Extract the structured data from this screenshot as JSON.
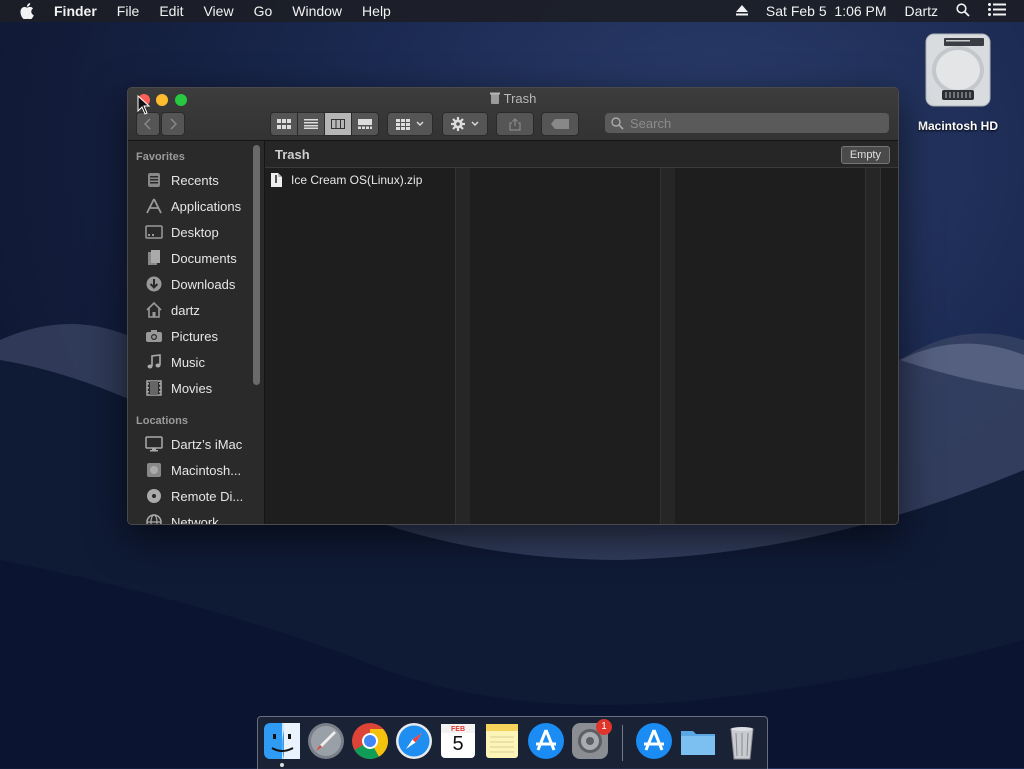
{
  "menubar": {
    "app_name": "Finder",
    "menus": [
      "File",
      "Edit",
      "View",
      "Go",
      "Window",
      "Help"
    ],
    "datetime": "Sat Feb 5  1:06 PM",
    "user": "Dartz"
  },
  "desktop": {
    "hd_label": "Macintosh HD"
  },
  "window": {
    "title": "Trash",
    "search_placeholder": "Search",
    "path_title": "Trash",
    "empty_label": "Empty",
    "files": [
      {
        "name": "Ice Cream OS(Linux).zip",
        "icon": "document-icon"
      }
    ]
  },
  "sidebar": {
    "favorites_header": "Favorites",
    "favorites": [
      {
        "label": "Recents",
        "icon": "recents-icon"
      },
      {
        "label": "Applications",
        "icon": "applications-icon"
      },
      {
        "label": "Desktop",
        "icon": "desktop-icon"
      },
      {
        "label": "Documents",
        "icon": "documents-icon"
      },
      {
        "label": "Downloads",
        "icon": "downloads-icon"
      },
      {
        "label": "dartz",
        "icon": "home-icon"
      },
      {
        "label": "Pictures",
        "icon": "camera-icon"
      },
      {
        "label": "Music",
        "icon": "music-icon"
      },
      {
        "label": "Movies",
        "icon": "movies-icon"
      }
    ],
    "locations_header": "Locations",
    "locations": [
      {
        "label": "Dartz’s iMac",
        "icon": "imac-icon"
      },
      {
        "label": "Macintosh...",
        "icon": "disk-icon"
      },
      {
        "label": "Remote Di...",
        "icon": "disc-icon"
      },
      {
        "label": "Network",
        "icon": "network-icon"
      }
    ]
  },
  "dock": {
    "apps": [
      "Finder",
      "Launchpad",
      "Chrome",
      "Safari",
      "Calendar",
      "Notes",
      "App Store",
      "System Preferences",
      "App Store Folder",
      "Folder",
      "Trash"
    ],
    "calendar_month": "FEB",
    "calendar_day": "5",
    "prefs_badge": "1"
  },
  "colors": {
    "close": "#ff5f57",
    "minimize": "#febc2e",
    "zoom": "#28c840",
    "desktop_bg": "#1b2a52"
  }
}
